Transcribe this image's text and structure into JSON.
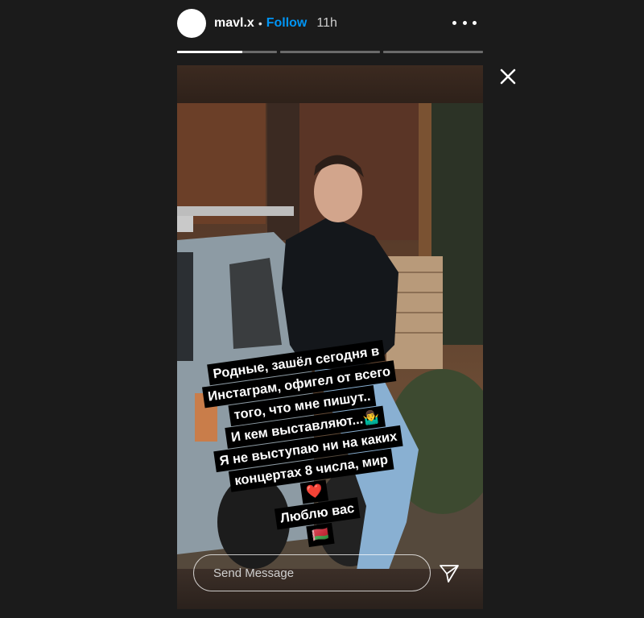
{
  "header": {
    "username": "mavl.x",
    "separator": "•",
    "follow_label": "Follow",
    "time": "11h",
    "more_icon": "more-horizontal-icon"
  },
  "progress": {
    "segments": [
      {
        "fill": 0.65
      },
      {
        "fill": 0
      },
      {
        "fill": 0
      }
    ]
  },
  "story": {
    "text_lines": [
      "Родные, зашёл сегодня в",
      "Инстаграм, офигел от всего",
      "того, что мне пишут..",
      "И кем выставляют...🤷‍♂️",
      "Я не выступаю ни на каких",
      "концертах 8 числа, мир",
      "❤️",
      "Люблю вас",
      "🇧🇾"
    ]
  },
  "reply": {
    "placeholder": "Send Message",
    "send_icon": "send-icon"
  },
  "close_icon": "close-icon",
  "colors": {
    "background": "#1b1b1b",
    "follow": "#0095f6"
  }
}
